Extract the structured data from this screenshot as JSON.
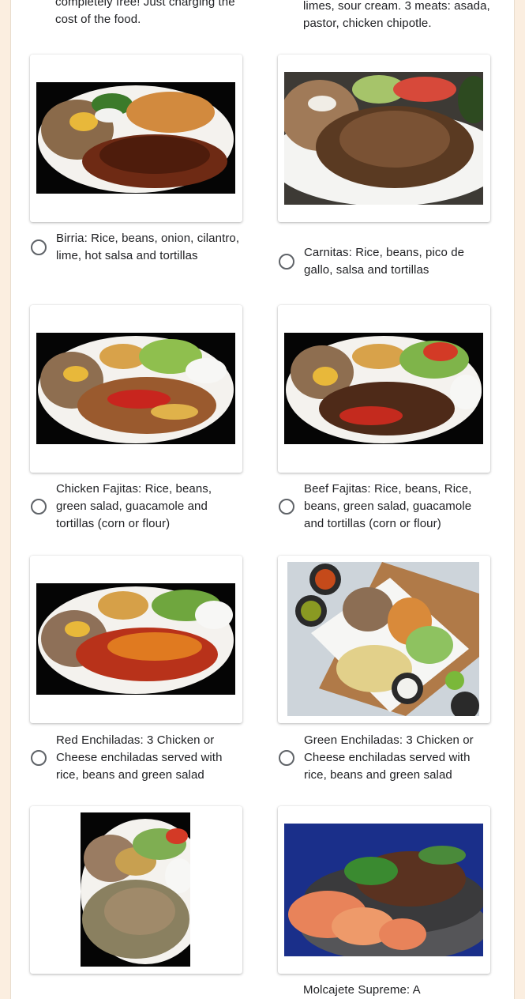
{
  "top": {
    "left_text": "completely free! Just charging the cost of the food.",
    "right_text": "limes, sour cream. 3 meats: asada, pastor, chicken chipotle."
  },
  "options": [
    {
      "label": "Birria: Rice, beans, onion, cilantro, lime, hot salsa and tortillas",
      "image": "birria-plate-image"
    },
    {
      "label": "Carnitas: Rice, beans, pico de gallo, salsa and tortillas",
      "image": "carnitas-plate-image"
    },
    {
      "label": "Chicken Fajitas: Rice, beans, green salad, guacamole and tortillas (corn or flour)",
      "image": "chicken-fajitas-image"
    },
    {
      "label": "Beef Fajitas: Rice, beans, Rice, beans, green salad, guacamole and tortillas (corn or flour)",
      "image": "beef-fajitas-image"
    },
    {
      "label": "Red Enchiladas: 3 Chicken or Cheese enchiladas served with rice, beans and green salad",
      "image": "red-enchiladas-image"
    },
    {
      "label": "Green Enchiladas: 3 Chicken or Cheese enchiladas served with rice, beans and green salad",
      "image": "green-enchiladas-image"
    },
    {
      "label": "",
      "image": "chile-verde-image"
    },
    {
      "label": "Molcajete Supreme: A",
      "image": "molcajete-image"
    }
  ],
  "colors": {
    "page_background": "#fbeee0",
    "radio_border": "#5f6368",
    "text": "#202124"
  }
}
